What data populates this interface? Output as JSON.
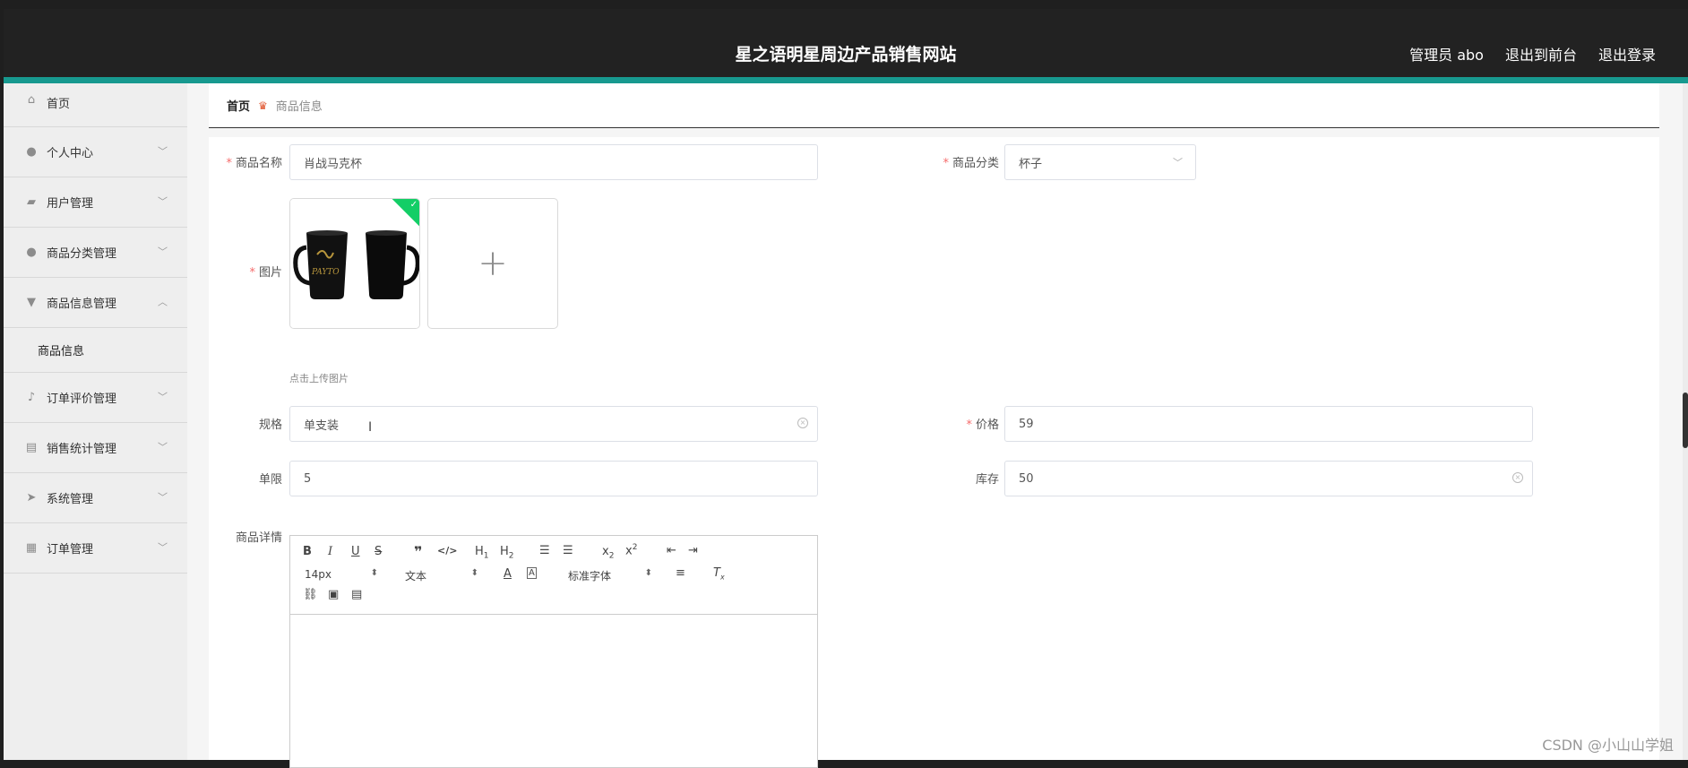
{
  "header": {
    "title": "星之语明星周边产品销售网站",
    "admin_label": "管理员 abo",
    "to_frontend": "退出到前台",
    "logout": "退出登录"
  },
  "sidebar": {
    "items": [
      {
        "label": "首页",
        "icon": "home-icon"
      },
      {
        "label": "个人中心",
        "icon": "user-icon"
      },
      {
        "label": "用户管理",
        "icon": "users-icon"
      },
      {
        "label": "商品分类管理",
        "icon": "person-icon"
      },
      {
        "label": "商品信息管理",
        "icon": "goods-icon",
        "expanded": true,
        "sub": [
          "商品信息"
        ]
      },
      {
        "label": "订单评价管理",
        "icon": "mic-icon"
      },
      {
        "label": "销售统计管理",
        "icon": "chart-icon"
      },
      {
        "label": "系统管理",
        "icon": "send-icon"
      },
      {
        "label": "订单管理",
        "icon": "grid-icon"
      }
    ]
  },
  "breadcrumb": {
    "home": "首页",
    "current": "商品信息"
  },
  "form": {
    "name_label": "商品名称",
    "name_value": "肖战马克杯",
    "category_label": "商品分类",
    "category_value": "杯子",
    "image_label": "图片",
    "upload_hint": "点击上传图片",
    "image_alt": "PAYTOY",
    "spec_label": "规格",
    "spec_value": "单支装",
    "price_label": "价格",
    "price_value": "59",
    "limit_label": "单限",
    "limit_value": "5",
    "stock_label": "库存",
    "stock_value": "50",
    "detail_label": "商品详情"
  },
  "editor": {
    "font_size": "14px",
    "header_select": "文本",
    "font_family": "标准字体"
  },
  "watermark": "CSDN @小山山学姐",
  "colors": {
    "accent": "#17998f",
    "success": "#13ce66",
    "required": "#f56c6c"
  }
}
